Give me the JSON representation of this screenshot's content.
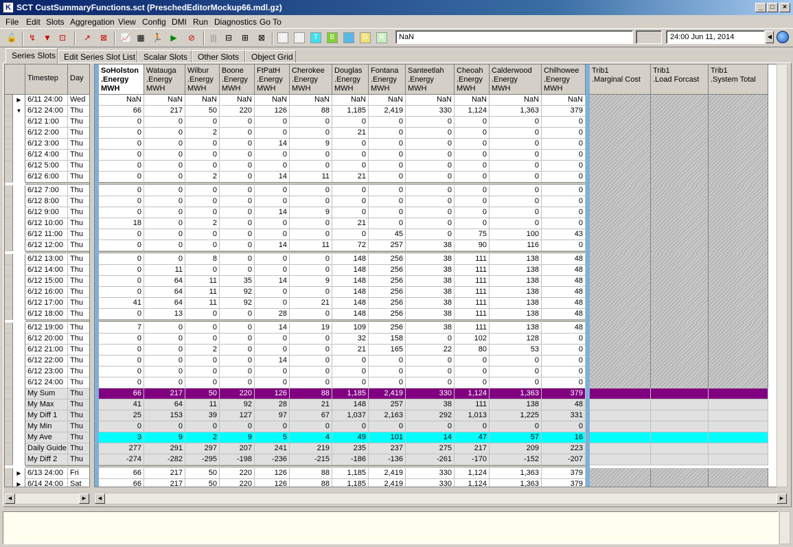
{
  "window": {
    "title": "SCT CustSummaryFunctions.sct (PreschedEditorMockup66.mdl.gz)"
  },
  "menu": [
    "File",
    "Edit",
    "Slots",
    "Aggregation",
    "View",
    "Config",
    "DMI",
    "Run",
    "Diagnostics",
    "Go To"
  ],
  "toolbar": {
    "value_field": "NaN",
    "datetime": "24:00 Jun 11, 2014",
    "letter_buttons": [
      "O",
      "I",
      "T",
      "B",
      "",
      "D",
      "R"
    ],
    "letter_colors": [
      "#f0f0f0",
      "#f0f0f0",
      "#40e0f0",
      "#80d030",
      "#58b8e8",
      "#f0e070",
      "#c8f0c0"
    ]
  },
  "tabs": [
    "Series Slots",
    "Edit Series Slot List",
    "Scalar Slots",
    "Other Slots",
    "Object Grid"
  ],
  "left_headers": [
    "Timestep",
    "Day"
  ],
  "columns": [
    {
      "l1": "SoHolston",
      "l2": ".Energy",
      "l3": "MWH"
    },
    {
      "l1": "Watauga",
      "l2": ".Energy",
      "l3": "MWH"
    },
    {
      "l1": "Wilbur",
      "l2": ".Energy",
      "l3": "MWH"
    },
    {
      "l1": "Boone",
      "l2": ".Energy",
      "l3": "MWH"
    },
    {
      "l1": "FtPatH",
      "l2": ".Energy",
      "l3": "MWH"
    },
    {
      "l1": "Cherokee",
      "l2": ".Energy",
      "l3": "MWH"
    },
    {
      "l1": "Douglas",
      "l2": ".Energy",
      "l3": "MWH"
    },
    {
      "l1": "Fontana",
      "l2": ".Energy",
      "l3": "MWH"
    },
    {
      "l1": "Santeetlah",
      "l2": ".Energy",
      "l3": "MWH"
    },
    {
      "l1": "Cheoah",
      "l2": ".Energy",
      "l3": "MWH"
    },
    {
      "l1": "Calderwood",
      "l2": ".Energy",
      "l3": "MWH"
    },
    {
      "l1": "Chilhowee",
      "l2": ".Energy",
      "l3": "MWH"
    }
  ],
  "trib_columns": [
    {
      "l1": "Trib1",
      "l2": ".Marginal Cost"
    },
    {
      "l1": "Trib1",
      "l2": ".Load Forcast"
    },
    {
      "l1": "Trib1",
      "l2": ".System Total"
    }
  ],
  "rows": [
    {
      "t": "6/11 24:00",
      "d": "Wed",
      "m": "▶",
      "k": "agg",
      "v": [
        "NaN",
        "NaN",
        "NaN",
        "NaN",
        "NaN",
        "NaN",
        "NaN",
        "NaN",
        "NaN",
        "NaN",
        "NaN",
        "NaN"
      ]
    },
    {
      "t": "6/12 24:00",
      "d": "Thu",
      "m": "▼",
      "k": "agg",
      "v": [
        "66",
        "217",
        "50",
        "220",
        "126",
        "88",
        "1,185",
        "2,419",
        "330",
        "1,124",
        "1,363",
        "379"
      ]
    },
    {
      "t": "6/12 1:00",
      "d": "Thu",
      "k": "h",
      "v": [
        "0",
        "0",
        "0",
        "0",
        "0",
        "0",
        "0",
        "0",
        "0",
        "0",
        "0",
        "0"
      ]
    },
    {
      "t": "6/12 2:00",
      "d": "Thu",
      "k": "h",
      "v": [
        "0",
        "0",
        "2",
        "0",
        "0",
        "0",
        "21",
        "0",
        "0",
        "0",
        "0",
        "0"
      ]
    },
    {
      "t": "6/12 3:00",
      "d": "Thu",
      "k": "h",
      "v": [
        "0",
        "0",
        "0",
        "0",
        "14",
        "9",
        "0",
        "0",
        "0",
        "0",
        "0",
        "0"
      ]
    },
    {
      "t": "6/12 4:00",
      "d": "Thu",
      "k": "h",
      "v": [
        "0",
        "0",
        "0",
        "0",
        "0",
        "0",
        "0",
        "0",
        "0",
        "0",
        "0",
        "0"
      ]
    },
    {
      "t": "6/12 5:00",
      "d": "Thu",
      "k": "h",
      "v": [
        "0",
        "0",
        "0",
        "0",
        "0",
        "0",
        "0",
        "0",
        "0",
        "0",
        "0",
        "0"
      ]
    },
    {
      "t": "6/12 6:00",
      "d": "Thu",
      "k": "h",
      "gap": true,
      "v": [
        "0",
        "0",
        "2",
        "0",
        "14",
        "11",
        "21",
        "0",
        "0",
        "0",
        "0",
        "0"
      ]
    },
    {
      "t": "6/12 7:00",
      "d": "Thu",
      "k": "h",
      "v": [
        "0",
        "0",
        "0",
        "0",
        "0",
        "0",
        "0",
        "0",
        "0",
        "0",
        "0",
        "0"
      ]
    },
    {
      "t": "6/12 8:00",
      "d": "Thu",
      "k": "h",
      "v": [
        "0",
        "0",
        "0",
        "0",
        "0",
        "0",
        "0",
        "0",
        "0",
        "0",
        "0",
        "0"
      ]
    },
    {
      "t": "6/12 9:00",
      "d": "Thu",
      "k": "h",
      "v": [
        "0",
        "0",
        "0",
        "0",
        "14",
        "9",
        "0",
        "0",
        "0",
        "0",
        "0",
        "0"
      ]
    },
    {
      "t": "6/12 10:00",
      "d": "Thu",
      "k": "h",
      "v": [
        "18",
        "0",
        "2",
        "0",
        "0",
        "0",
        "21",
        "0",
        "0",
        "0",
        "0",
        "0"
      ]
    },
    {
      "t": "6/12 11:00",
      "d": "Thu",
      "k": "h",
      "v": [
        "0",
        "0",
        "0",
        "0",
        "0",
        "0",
        "0",
        "45",
        "0",
        "75",
        "100",
        "43"
      ]
    },
    {
      "t": "6/12 12:00",
      "d": "Thu",
      "k": "h",
      "gap": true,
      "v": [
        "0",
        "0",
        "0",
        "0",
        "14",
        "11",
        "72",
        "257",
        "38",
        "90",
        "116",
        "0"
      ]
    },
    {
      "t": "6/12 13:00",
      "d": "Thu",
      "k": "h",
      "v": [
        "0",
        "0",
        "8",
        "0",
        "0",
        "0",
        "148",
        "256",
        "38",
        "111",
        "138",
        "48"
      ]
    },
    {
      "t": "6/12 14:00",
      "d": "Thu",
      "k": "h",
      "v": [
        "0",
        "11",
        "0",
        "0",
        "0",
        "0",
        "148",
        "256",
        "38",
        "111",
        "138",
        "48"
      ]
    },
    {
      "t": "6/12 15:00",
      "d": "Thu",
      "k": "h",
      "v": [
        "0",
        "64",
        "11",
        "35",
        "14",
        "9",
        "148",
        "256",
        "38",
        "111",
        "138",
        "48"
      ]
    },
    {
      "t": "6/12 16:00",
      "d": "Thu",
      "k": "h",
      "v": [
        "0",
        "64",
        "11",
        "92",
        "0",
        "0",
        "148",
        "256",
        "38",
        "111",
        "138",
        "48"
      ]
    },
    {
      "t": "6/12 17:00",
      "d": "Thu",
      "k": "h",
      "v": [
        "41",
        "64",
        "11",
        "92",
        "0",
        "21",
        "148",
        "256",
        "38",
        "111",
        "138",
        "48"
      ]
    },
    {
      "t": "6/12 18:00",
      "d": "Thu",
      "k": "h",
      "gap": true,
      "v": [
        "0",
        "13",
        "0",
        "0",
        "28",
        "0",
        "148",
        "256",
        "38",
        "111",
        "138",
        "48"
      ]
    },
    {
      "t": "6/12 19:00",
      "d": "Thu",
      "k": "h",
      "v": [
        "7",
        "0",
        "0",
        "0",
        "14",
        "19",
        "109",
        "256",
        "38",
        "111",
        "138",
        "48"
      ]
    },
    {
      "t": "6/12 20:00",
      "d": "Thu",
      "k": "h",
      "v": [
        "0",
        "0",
        "0",
        "0",
        "0",
        "0",
        "32",
        "158",
        "0",
        "102",
        "128",
        "0"
      ]
    },
    {
      "t": "6/12 21:00",
      "d": "Thu",
      "k": "h",
      "v": [
        "0",
        "0",
        "2",
        "0",
        "0",
        "0",
        "21",
        "165",
        "22",
        "80",
        "53",
        "0"
      ]
    },
    {
      "t": "6/12 22:00",
      "d": "Thu",
      "k": "h",
      "v": [
        "0",
        "0",
        "0",
        "0",
        "14",
        "0",
        "0",
        "0",
        "0",
        "0",
        "0",
        "0"
      ]
    },
    {
      "t": "6/12 23:00",
      "d": "Thu",
      "k": "h",
      "v": [
        "0",
        "0",
        "0",
        "0",
        "0",
        "0",
        "0",
        "0",
        "0",
        "0",
        "0",
        "0"
      ]
    },
    {
      "t": "6/12 24:00",
      "d": "Thu",
      "k": "h",
      "v": [
        "0",
        "0",
        "0",
        "0",
        "0",
        "0",
        "0",
        "0",
        "0",
        "0",
        "0",
        "0"
      ]
    },
    {
      "t": "My Sum",
      "d": "Thu",
      "k": "sum",
      "v": [
        "66",
        "217",
        "50",
        "220",
        "126",
        "88",
        "1,185",
        "2,419",
        "330",
        "1,124",
        "1,363",
        "379"
      ]
    },
    {
      "t": "My Max",
      "d": "Thu",
      "k": "s",
      "v": [
        "41",
        "64",
        "11",
        "92",
        "28",
        "21",
        "148",
        "257",
        "38",
        "111",
        "138",
        "48"
      ]
    },
    {
      "t": "My Diff 1",
      "d": "Thu",
      "k": "s",
      "v": [
        "25",
        "153",
        "39",
        "127",
        "97",
        "67",
        "1,037",
        "2,163",
        "292",
        "1,013",
        "1,225",
        "331"
      ]
    },
    {
      "t": "My Min",
      "d": "Thu",
      "k": "s",
      "v": [
        "0",
        "0",
        "0",
        "0",
        "0",
        "0",
        "0",
        "0",
        "0",
        "0",
        "0",
        "0"
      ]
    },
    {
      "t": "My Ave",
      "d": "Thu",
      "k": "ave",
      "v": [
        "3",
        "9",
        "2",
        "9",
        "5",
        "4",
        "49",
        "101",
        "14",
        "47",
        "57",
        "16"
      ]
    },
    {
      "t": "Daily Guide",
      "d": "Thu",
      "k": "s",
      "v": [
        "277",
        "291",
        "297",
        "207",
        "241",
        "219",
        "235",
        "237",
        "275",
        "217",
        "209",
        "223"
      ]
    },
    {
      "t": "My Diff 2",
      "d": "Thu",
      "k": "s",
      "gap": true,
      "v": [
        "-274",
        "-282",
        "-295",
        "-198",
        "-236",
        "-215",
        "-186",
        "-136",
        "-261",
        "-170",
        "-152",
        "-207"
      ]
    },
    {
      "t": "6/13 24:00",
      "d": "Fri",
      "m": "▶",
      "k": "agg",
      "v": [
        "66",
        "217",
        "50",
        "220",
        "126",
        "88",
        "1,185",
        "2,419",
        "330",
        "1,124",
        "1,363",
        "379"
      ]
    },
    {
      "t": "6/14 24:00",
      "d": "Sat",
      "m": "▶",
      "k": "agg",
      "v": [
        "66",
        "217",
        "50",
        "220",
        "126",
        "88",
        "1,185",
        "2,419",
        "330",
        "1,124",
        "1,363",
        "379"
      ]
    }
  ],
  "colors": {
    "sum_row": "#800080",
    "ave_row": "#00ffff",
    "summary_bg": "#e0e0e0",
    "sel_strip": "#7fb0d8"
  }
}
